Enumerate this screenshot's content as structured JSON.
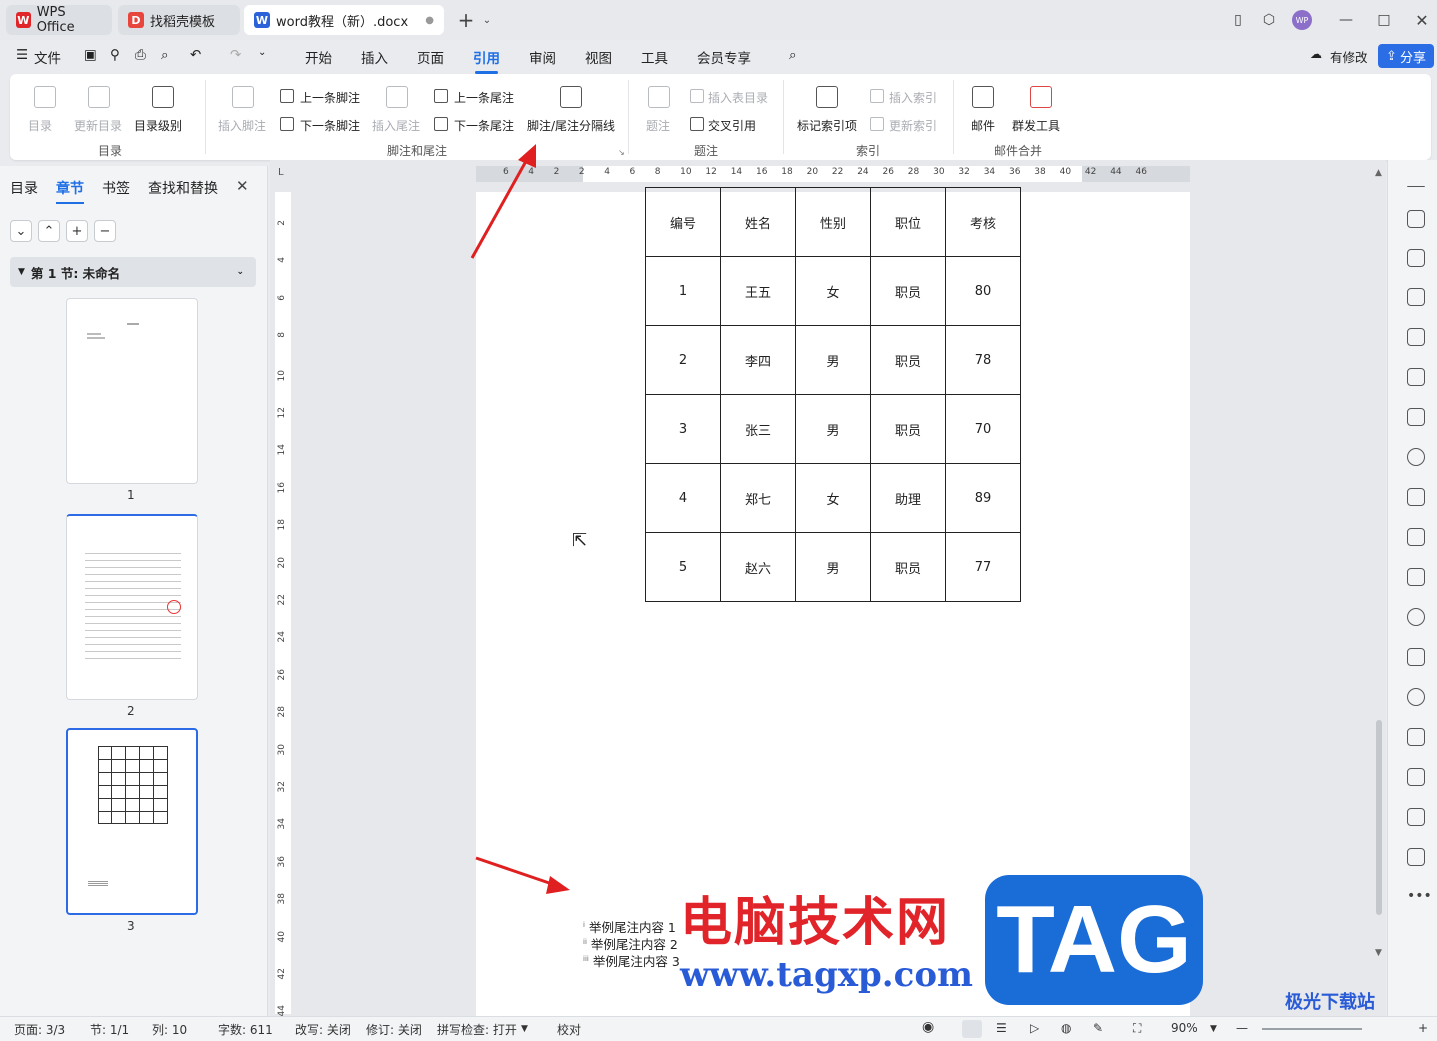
{
  "tabs": [
    {
      "label": "WPS Office",
      "icon": "wps-logo-icon"
    },
    {
      "label": "找稻壳模板",
      "icon": "docer-icon"
    },
    {
      "label": "word教程（新）.docx",
      "icon": "word-doc-icon"
    }
  ],
  "window": {
    "avatar": "WP"
  },
  "menu": {
    "file": "文件",
    "items": [
      "开始",
      "插入",
      "页面",
      "引用",
      "审阅",
      "视图",
      "工具",
      "会员专享"
    ],
    "active": "引用",
    "modified": "有修改",
    "share": "分享"
  },
  "ribbon": {
    "toc": {
      "toc": "目录",
      "update_toc": "更新目录",
      "toc_level": "目录级别",
      "group": "目录"
    },
    "footnote": {
      "insert_footnote": "插入脚注",
      "prev_footnote": "上一条脚注",
      "next_footnote": "下一条脚注",
      "insert_endnote": "插入尾注",
      "prev_endnote": "上一条尾注",
      "next_endnote": "下一条尾注",
      "separator": "脚注/尾注分隔线",
      "group": "脚注和尾注"
    },
    "caption": {
      "caption": "题注",
      "insert_table_toc": "插入表目录",
      "cross_ref": "交叉引用",
      "group": "题注"
    },
    "index": {
      "mark_entry": "标记索引项",
      "insert_index": "插入索引",
      "update_index": "更新索引",
      "group": "索引"
    },
    "mail": {
      "mail": "邮件",
      "mass_tool": "群发工具",
      "group": "邮件合并"
    }
  },
  "left_panel": {
    "tabs": [
      "目录",
      "章节",
      "书签",
      "查找和替换"
    ],
    "active_tab": "章节",
    "section": "第 1 节: 未命名",
    "pages": [
      "1",
      "2",
      "3"
    ]
  },
  "ruler": {
    "h_ticks": [
      "6",
      "4",
      "2",
      "2",
      "4",
      "6",
      "8",
      "10",
      "12",
      "14",
      "16",
      "18",
      "20",
      "22",
      "24",
      "26",
      "28",
      "30",
      "32",
      "34",
      "36",
      "38",
      "40",
      "42",
      "44",
      "46"
    ],
    "v_ticks": [
      "2",
      "4",
      "6",
      "8",
      "10",
      "12",
      "14",
      "16",
      "18",
      "20",
      "22",
      "24",
      "26",
      "28",
      "30",
      "32",
      "34",
      "36",
      "38",
      "40",
      "42",
      "44"
    ]
  },
  "table": {
    "headers": [
      "编号",
      "姓名",
      "性别",
      "职位",
      "考核"
    ],
    "rows": [
      [
        "1",
        "王五",
        "女",
        "职员",
        "80"
      ],
      [
        "2",
        "李四",
        "男",
        "职员",
        "78"
      ],
      [
        "3",
        "张三",
        "男",
        "职员",
        "70"
      ],
      [
        "4",
        "郑七",
        "女",
        "助理",
        "89"
      ],
      [
        "5",
        "赵六",
        "男",
        "职员",
        "77"
      ]
    ]
  },
  "endnotes": [
    {
      "mark": "i",
      "text": "举例尾注内容 1"
    },
    {
      "mark": "ii",
      "text": "举例尾注内容 2"
    },
    {
      "mark": "iii",
      "text": "举例尾注内容 3"
    }
  ],
  "status": {
    "page": "页面: 3/3",
    "section": "节: 1/1",
    "column": "列: 10",
    "words": "字数: 611",
    "overwrite": "改写: 关闭",
    "revision": "修订: 关闭",
    "spell": "拼写检查: 打开",
    "proofread": "校对",
    "zoom": "90%"
  },
  "watermark": {
    "text": "电脑技术网",
    "url": "www.tagxp.com",
    "tag": "TAG",
    "corner": "极光下载站"
  },
  "colors": {
    "accent": "#1f6fe5",
    "arrow": "#e02020",
    "watermark_red": "#e0242a",
    "watermark_blue": "#1a6cd6"
  }
}
